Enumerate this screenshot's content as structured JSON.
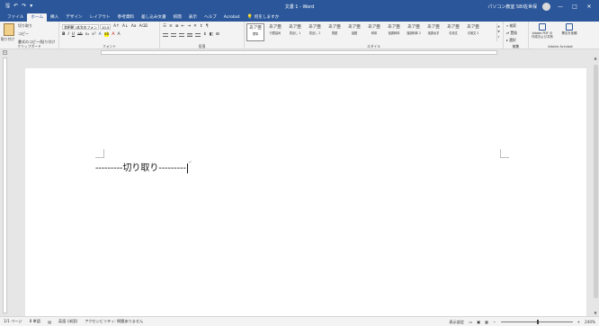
{
  "window": {
    "title": "文書 1 - Word",
    "user": "パソコン教室 SBI佐世保",
    "controls": {
      "minimize": "—",
      "maximize": "□",
      "close": "✕"
    }
  },
  "tabs": [
    "ファイル",
    "ホーム",
    "挿入",
    "デザイン",
    "レイアウト",
    "参考資料",
    "差し込み文書",
    "校閲",
    "表示",
    "ヘルプ",
    "Acrobat"
  ],
  "active_tab_index": 1,
  "tell_me": "何をしますか",
  "ribbon": {
    "clipboard": {
      "paste_label": "貼り付け",
      "cut": "切り取り",
      "copy": "コピー",
      "format_painter": "書式のコピー/貼り付け",
      "group_label": "クリップボード"
    },
    "font": {
      "font_name": "游明朝 (本文のフォン",
      "font_size": "10.5",
      "group_label": "フォント"
    },
    "paragraph": {
      "group_label": "段落"
    },
    "styles": {
      "items": [
        {
          "sample": "あア亜",
          "name": "標準",
          "blue": false
        },
        {
          "sample": "あア亜",
          "name": "行間詰め",
          "blue": false
        },
        {
          "sample": "あア亜",
          "name": "見出し 1",
          "blue": false
        },
        {
          "sample": "あア亜",
          "name": "見出し 2",
          "blue": false
        },
        {
          "sample": "あア亜",
          "name": "表題",
          "blue": false
        },
        {
          "sample": "あア亜",
          "name": "副題",
          "blue": false
        },
        {
          "sample": "あア亜",
          "name": "斜体",
          "blue": false
        },
        {
          "sample": "あア亜",
          "name": "強調斜体",
          "blue": false
        },
        {
          "sample": "あア亜",
          "name": "強調斜体 2",
          "blue": false
        },
        {
          "sample": "あア亜",
          "name": "強調太字",
          "blue": false
        },
        {
          "sample": "あア亜",
          "name": "引用文",
          "blue": false
        },
        {
          "sample": "あア亜",
          "name": "引用文 2",
          "blue": false
        }
      ],
      "group_label": "スタイル"
    },
    "editing": {
      "find": "検索",
      "replace": "置換",
      "select": "選択",
      "group_label": "編集"
    },
    "acrobat": {
      "create_pdf": "Adobe PDF の作成および共有",
      "request_sign": "署名を依頼",
      "group_label": "Adobe Acrobat"
    }
  },
  "document": {
    "text": "---------切り取り---------",
    "para_mark": "↵"
  },
  "status": {
    "page": "1/1 ページ",
    "words": "8 単語",
    "lang": "英語 (米国)",
    "accessibility": "アクセシビリティ: 問題ありません",
    "view": "表示設定",
    "zoom": "240%"
  }
}
